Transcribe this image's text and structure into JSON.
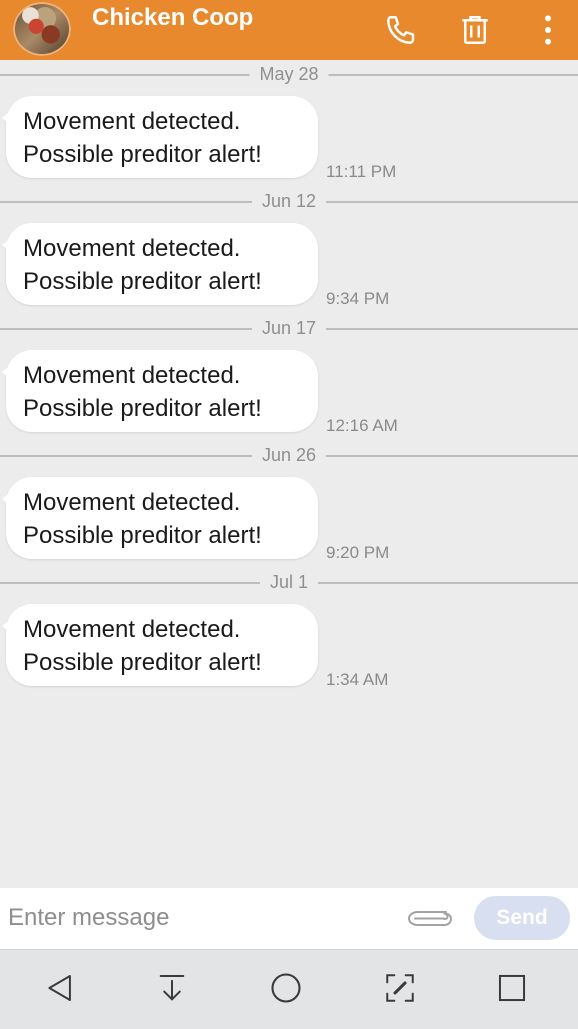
{
  "header": {
    "contact_name": "Chicken Coop",
    "background_color": "#e8892e",
    "icons": [
      "avatar",
      "phone-icon",
      "trash-icon",
      "more-vert-icon"
    ]
  },
  "messages": [
    {
      "date": "May 28",
      "text": "Movement detected.\nPossible preditor alert!",
      "time": "11:11 PM"
    },
    {
      "date": "Jun 12",
      "text": "Movement detected.\nPossible preditor alert!",
      "time": "9:34 PM"
    },
    {
      "date": "Jun 17",
      "text": "Movement detected.\nPossible preditor alert!",
      "time": "12:16 AM"
    },
    {
      "date": "Jun 26",
      "text": "Movement detected.\nPossible preditor alert!",
      "time": "9:20 PM"
    },
    {
      "date": "Jul 1",
      "text": "Movement detected.\nPossible preditor alert!",
      "time": "1:34 AM"
    }
  ],
  "composer": {
    "placeholder": "Enter message",
    "value": "",
    "send_label": "Send",
    "attach_icon": "paperclip-icon"
  },
  "navigation": {
    "buttons": [
      "back-icon",
      "notification-pull-icon",
      "home-icon",
      "capture-icon",
      "recents-icon"
    ],
    "background_color": "#e3e4e6"
  }
}
